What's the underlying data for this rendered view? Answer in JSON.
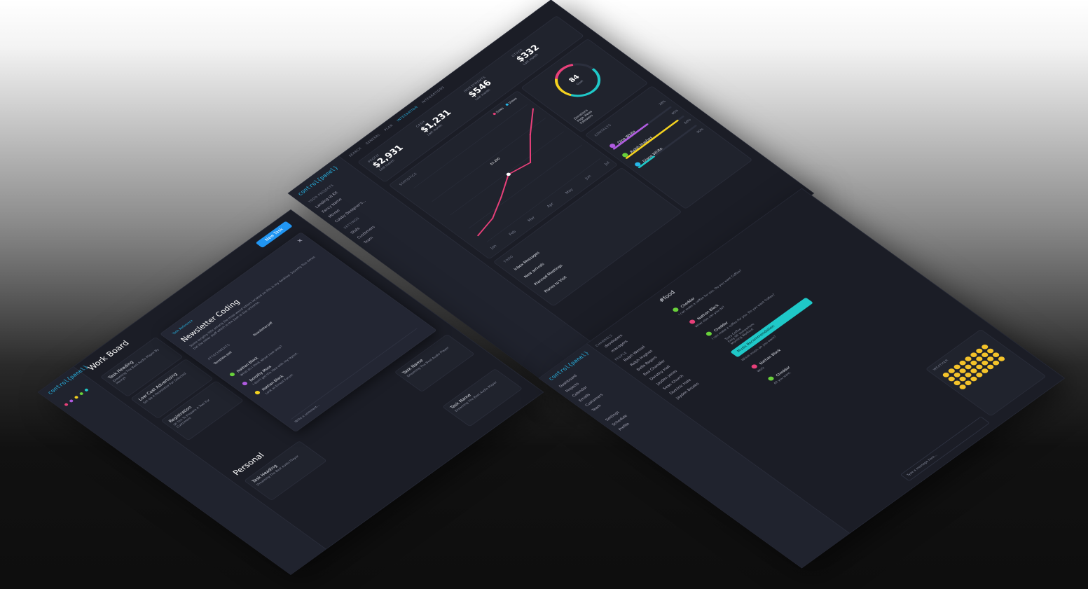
{
  "colors": {
    "accent": "#27b7e8",
    "pink": "#e8407a",
    "yellow": "#f4d21f",
    "teal": "#1fc8c8",
    "purple": "#b05be0",
    "green": "#69d13b",
    "blue": "#2196f3"
  },
  "dashboard": {
    "logo": "control{panel}",
    "search_label": "Search",
    "tabs": [
      "GENERAL",
      "PLAN",
      "INTEGRATION",
      "INTEGRATIONS"
    ],
    "sidebar_section": "Todo Projects",
    "projects": [
      "Landing UI Kit",
      "Fancy Name",
      "Moveo",
      "Cobby Designer's..."
    ],
    "sidebar_section2": "Settings",
    "nav": [
      "Stats",
      "Customers",
      "Team"
    ],
    "user": "Evan Mitchell",
    "stats": [
      {
        "label": "PROFIT",
        "value": "$2,931",
        "note": "Last month"
      },
      {
        "label": "CASH",
        "value": "$1,231",
        "note": "Last month"
      },
      {
        "label": "INVESTMENTS",
        "value": "$546",
        "note": "Last month"
      },
      {
        "label": "OTHER",
        "value": "$332",
        "note": "Last month"
      }
    ],
    "chart_title": "STATISTICS",
    "legend": [
      "Sales",
      "Views"
    ],
    "tooltip_value": "$1,200",
    "ring_value": "84",
    "ring_label": "Goal",
    "ring_legend": [
      "Donations",
      "Page Views",
      "Followers"
    ],
    "people_title": "CONTACTS",
    "people": [
      "Dina White",
      "Ralph Hughes",
      "Diane White"
    ],
    "people_pct": [
      "28%",
      "60%",
      "60%",
      "90%"
    ],
    "todo_title": "TODO",
    "todos": [
      "Inbox Messages",
      "New arrivals",
      "Planned Meetings",
      "Places to Visit"
    ]
  },
  "chart_data": {
    "type": "line",
    "categories": [
      "Jan",
      "Feb",
      "Mar",
      "Apr",
      "May",
      "Jun",
      "Jul"
    ],
    "series": [
      {
        "name": "Sales",
        "values": [
          30,
          45,
          80,
          120,
          110,
          175,
          230
        ]
      }
    ],
    "ylim": [
      0,
      250
    ],
    "grid": true
  },
  "workboard": {
    "logo": "control{panel}",
    "title": "Work Board",
    "personal_title": "Personal",
    "new_task_label": "New Task",
    "cards": [
      {
        "title": "Task Heading",
        "text": "Dreaming The Best Audio Player By Henryk"
      },
      {
        "title": "Low Cost Advertising",
        "text": "Set Up A Newsletter For Selected"
      },
      {
        "title": "Registration",
        "text": "Ut Tim To Prepare A Text For Customers"
      },
      {
        "title": "Task Heading",
        "text": "Dreaming The Best Audio Player"
      },
      {
        "title": "Task Name",
        "text": "Dreaming The Best Audio Player"
      },
      {
        "title": "Task Name",
        "text": "Dreaming The Best Audio Player"
      }
    ],
    "modal": {
      "badge": "Todo Reference",
      "title": "Newsletter Coding",
      "desc": "Some lengthy title among the most weird letters located on this is my desktop. Seventy five times but the other stuff which is the best in the universe.",
      "attachments_label": "Attachments",
      "files": [
        "Template.psd",
        "Newsletter.pdf"
      ],
      "comment_placeholder": "Write a comment..."
    },
    "comments": [
      {
        "name": "Nathan Black",
        "text": "What do I think about next step?"
      },
      {
        "name": "Dorothy Moss",
        "text": "I don't get the idea with my layout."
      },
      {
        "name": "Nathan Black",
        "text": "Look at Ernest Forum"
      }
    ]
  },
  "chat": {
    "logo": "control{panel}",
    "nav": [
      "Dashboard",
      "Projects",
      "Calendar",
      "Emails",
      "Customers",
      "Team"
    ],
    "channels_title": "Channels",
    "channels": [
      "developers",
      "managers"
    ],
    "contacts_title": "People",
    "contacts": [
      "Ralph Wessel",
      "Ralph Hughes",
      "Bella Rogers",
      "Bea Chandler",
      "Dorothy Hall",
      "Jayden Jones",
      "Sean Church",
      "Dominic Hale",
      "Jayden Brooks"
    ],
    "settings": [
      "Settings",
      "Schedule",
      "Profile"
    ],
    "channel_name": "#food",
    "messages": [
      {
        "name": "Cheddar",
        "text": "I can make a coffee for you. Do you want Coffee?"
      },
      {
        "name": "Nathan Black",
        "text": "What else can you do?"
      },
      {
        "name": "Cheddar",
        "text": "I can make a coffee for you. Do you want Coffee?"
      },
      {
        "name": "Nathan Black",
        "text": "Work"
      },
      {
        "name": "Cheddar",
        "text": "All you want."
      }
    ],
    "options": [
      "Tasty Coffee",
      "Easy lift somewhere",
      "Morning Workout"
    ],
    "highlight": "Which music do you want?",
    "action_label": "Music Recommendation",
    "input_placeholder": "Type a message here...",
    "weather_label": "Weather"
  }
}
